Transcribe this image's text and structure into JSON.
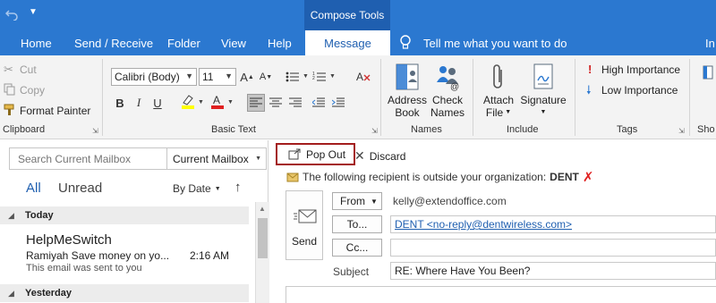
{
  "window": {
    "context_tab_label": "Compose Tools"
  },
  "tabs": [
    {
      "label": "Home"
    },
    {
      "label": "Send / Receive"
    },
    {
      "label": "Folder"
    },
    {
      "label": "View"
    },
    {
      "label": "Help"
    },
    {
      "label": "Message",
      "active": true
    },
    {
      "label": "In"
    }
  ],
  "tell_me": "Tell me what you want to do",
  "ribbon": {
    "clipboard": {
      "cut": "Cut",
      "copy": "Copy",
      "format_painter": "Format Painter",
      "group_label": "Clipboard"
    },
    "basic_text": {
      "font": "Calibri (Body)",
      "size": "11",
      "group_label": "Basic Text"
    },
    "names": {
      "address_book_l1": "Address",
      "address_book_l2": "Book",
      "check_names_l1": "Check",
      "check_names_l2": "Names",
      "group_label": "Names"
    },
    "include": {
      "attach_l1": "Attach",
      "attach_l2": "File",
      "signature": "Signature",
      "group_label": "Include"
    },
    "tags": {
      "high": "High Importance",
      "low": "Low Importance",
      "group_label": "Tags"
    },
    "show_group_label": "Sho"
  },
  "mailbox": {
    "search_placeholder": "Search Current Mailbox",
    "scope": "Current Mailbox",
    "filter_all": "All",
    "filter_unread": "Unread",
    "sort": "By Date",
    "sections": [
      {
        "label": "Today"
      },
      {
        "label": "Yesterday"
      }
    ],
    "messages": [
      {
        "sender": "HelpMeSwitch",
        "subject": "Ramiyah Save money on yo...",
        "time": "2:16 AM",
        "preview": "This email was sent to you"
      }
    ]
  },
  "compose": {
    "pop_out": "Pop Out",
    "discard": "Discard",
    "warning": "The following recipient is outside your organization:",
    "warning_name": "DENT",
    "send": "Send",
    "from_label": "From",
    "from_value": "kelly@extendoffice.com",
    "to_label": "To...",
    "to_value": "DENT <no-reply@dentwireless.com>",
    "cc_label": "Cc...",
    "cc_value": "",
    "subject_label": "Subject",
    "subject_value": "RE: Where Have You Been?"
  },
  "colors": {
    "brand": "#2b78d0",
    "brand_dark": "#1f5fb0",
    "highlight_border": "#a31d1d",
    "link": "#1f5fb0"
  }
}
